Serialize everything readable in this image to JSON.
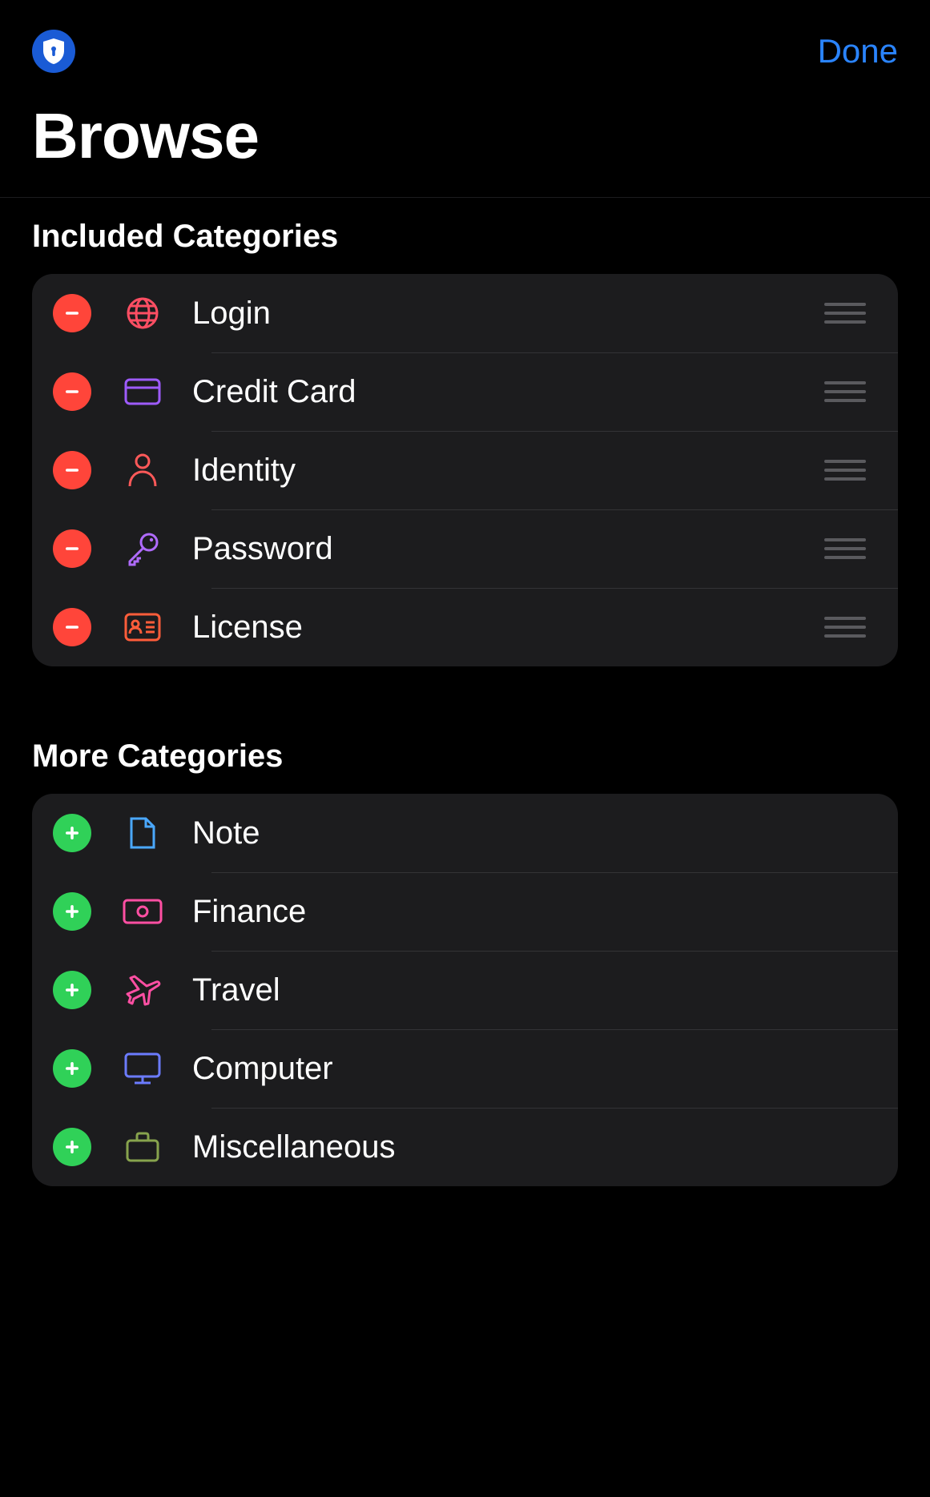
{
  "header": {
    "done_label": "Done"
  },
  "page_title": "Browse",
  "sections": {
    "included": {
      "heading": "Included Categories",
      "items": [
        {
          "label": "Login",
          "icon": "globe-icon",
          "icon_color": "#ff4e63"
        },
        {
          "label": "Credit Card",
          "icon": "card-icon",
          "icon_color": "#9e5bff"
        },
        {
          "label": "Identity",
          "icon": "person-icon",
          "icon_color": "#ff5959"
        },
        {
          "label": "Password",
          "icon": "key-icon",
          "icon_color": "#b06bff"
        },
        {
          "label": "License",
          "icon": "id-icon",
          "icon_color": "#ff5d3a"
        }
      ]
    },
    "more": {
      "heading": "More Categories",
      "items": [
        {
          "label": "Note",
          "icon": "note-icon",
          "icon_color": "#4aa8ff"
        },
        {
          "label": "Finance",
          "icon": "money-icon",
          "icon_color": "#ff4fa3"
        },
        {
          "label": "Travel",
          "icon": "plane-icon",
          "icon_color": "#ff4fa3"
        },
        {
          "label": "Computer",
          "icon": "monitor-icon",
          "icon_color": "#6b7bff"
        },
        {
          "label": "Miscellaneous",
          "icon": "briefcase-icon",
          "icon_color": "#87a34d"
        }
      ]
    }
  }
}
